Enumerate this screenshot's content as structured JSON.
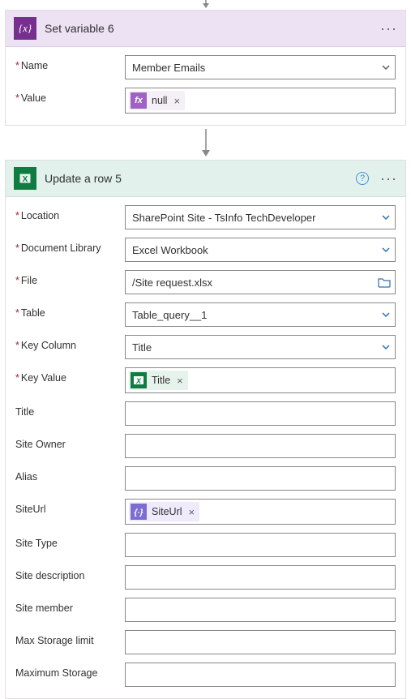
{
  "card1": {
    "title": "Set variable 6",
    "fields": {
      "name_label": "Name",
      "name_value": "Member Emails",
      "value_label": "Value",
      "value_token": "null"
    }
  },
  "card2": {
    "title": "Update a row 5",
    "fields": {
      "location_label": "Location",
      "location_value": "SharePoint Site - TsInfo TechDeveloper",
      "doclib_label": "Document Library",
      "doclib_value": "Excel Workbook",
      "file_label": "File",
      "file_value": "/Site request.xlsx",
      "table_label": "Table",
      "table_value": "Table_query__1",
      "keycol_label": "Key Column",
      "keycol_value": "Title",
      "keyval_label": "Key Value",
      "keyval_token": "Title",
      "title_label": "Title",
      "siteowner_label": "Site Owner",
      "alias_label": "Alias",
      "siteurl_label": "SiteUrl",
      "siteurl_token": "SiteUrl",
      "sitetype_label": "Site Type",
      "sitedesc_label": "Site description",
      "sitemember_label": "Site member",
      "maxstoragelimit_label": "Max Storage limit",
      "maxstorage_label": "Maximum Storage"
    }
  },
  "icons": {
    "fx": "fx",
    "curly": "{𝑥}"
  }
}
